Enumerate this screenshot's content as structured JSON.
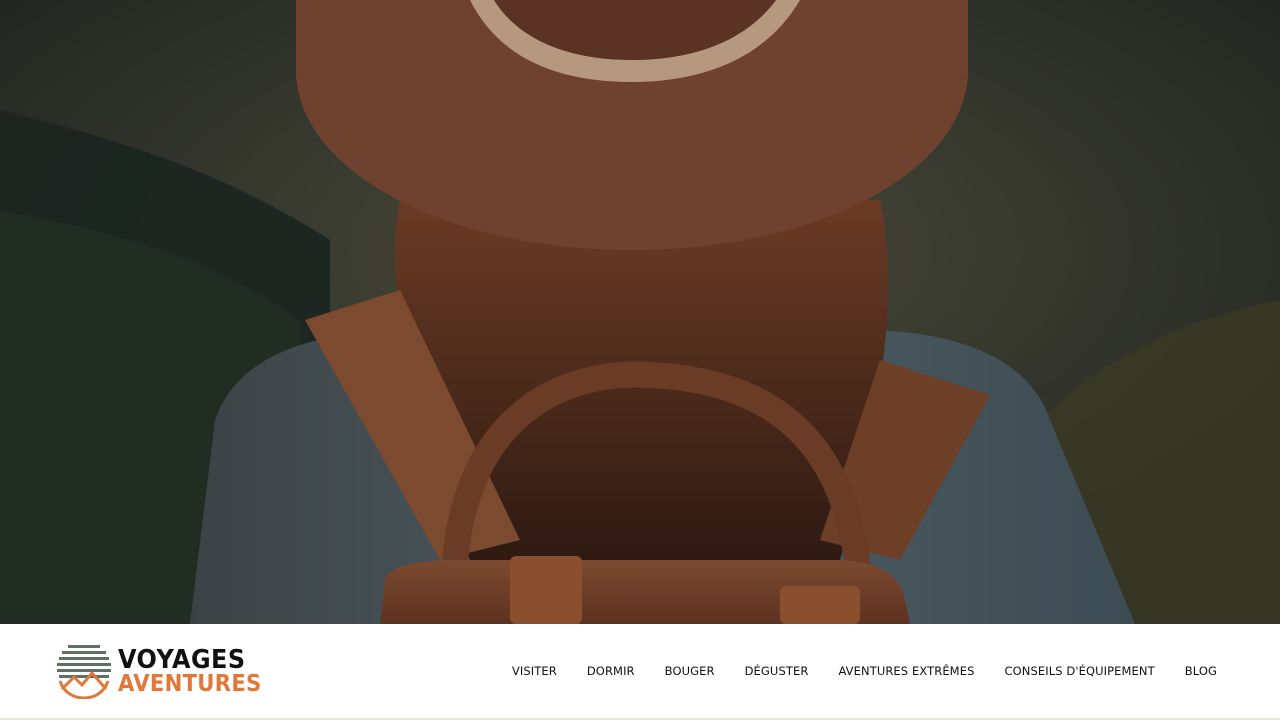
{
  "brand": {
    "line1": "VOYAGES",
    "line2": "AVENTURES",
    "accent_color": "#e0783a",
    "dark_color": "#111111",
    "mark_color": "#5f7160"
  },
  "hero": {
    "image": "backpacker-woman-hat-mountains"
  },
  "nav": {
    "items": [
      {
        "id": "visiter",
        "label": "VISITER"
      },
      {
        "id": "dormir",
        "label": "DORMIR"
      },
      {
        "id": "bouger",
        "label": "BOUGER"
      },
      {
        "id": "deguster",
        "label": "DÉGUSTER"
      },
      {
        "id": "aventures-extremes",
        "label": "AVENTURES EXTRÊMES"
      },
      {
        "id": "conseils-equipement",
        "label": "CONSEILS D'ÉQUIPEMENT"
      },
      {
        "id": "blog",
        "label": "BLOG"
      }
    ]
  }
}
